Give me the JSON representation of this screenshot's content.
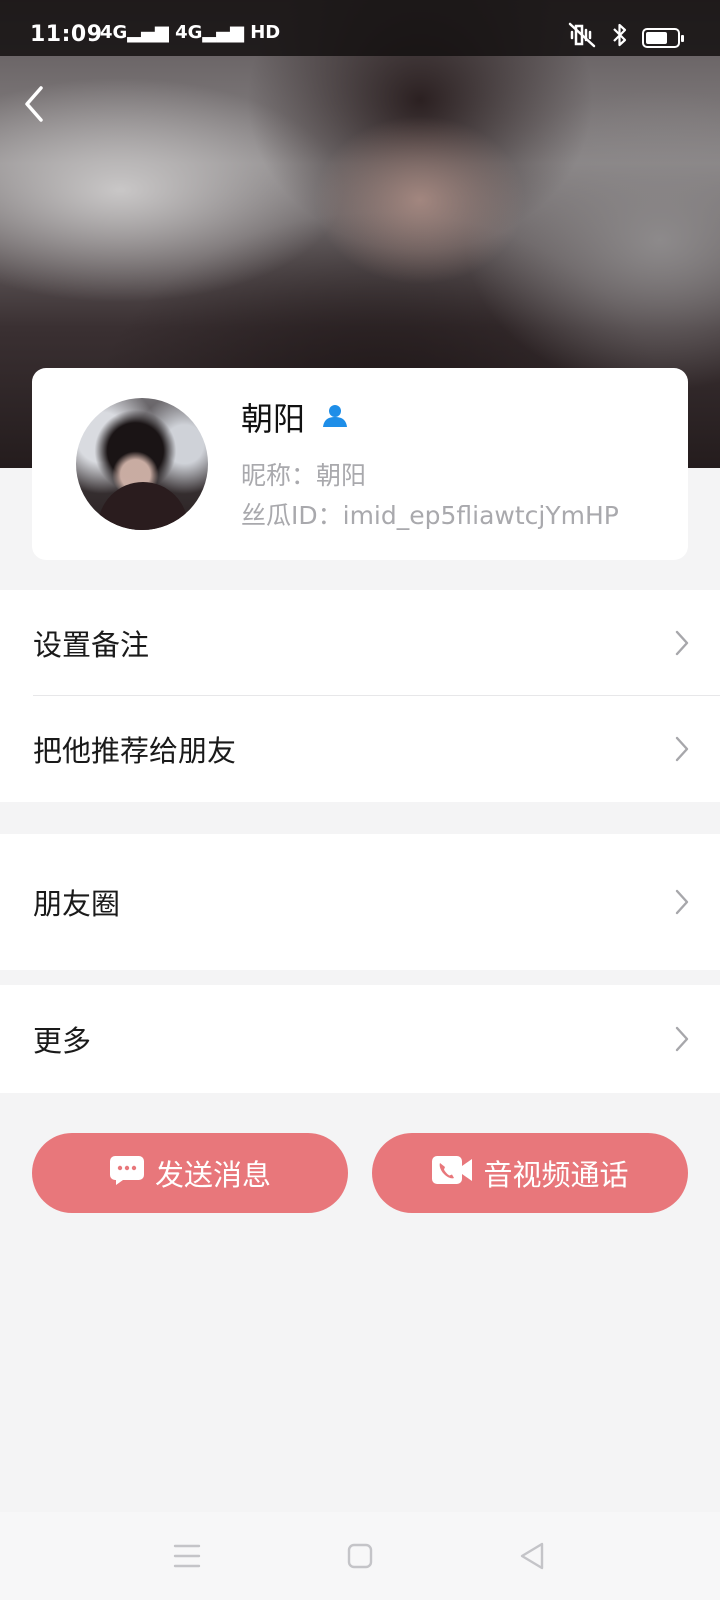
{
  "status_bar": {
    "time": "11:09",
    "signal": "4G▂▄▆ 4G▂▄▆ HD",
    "icons": [
      "mute-vibrate-icon",
      "bluetooth-icon",
      "battery-icon"
    ],
    "battery_level": 0.7
  },
  "header": {
    "back_icon": "chevron-left-icon"
  },
  "profile": {
    "name": "朝阳",
    "name_badge_icon": "person-icon",
    "nickname": "昵称：朝阳",
    "id": "丝瓜ID：imid_ep5fliawtcjYmHP"
  },
  "menu": {
    "group1": [
      {
        "label": "设置备注"
      },
      {
        "label": "把他推荐给朋友"
      }
    ],
    "group2": [
      {
        "label": "朋友圈"
      }
    ],
    "group3": [
      {
        "label": "更多"
      }
    ]
  },
  "actions": {
    "send_message": "发送消息",
    "av_call": "音视频通话"
  },
  "colors": {
    "accent": "#e8777b",
    "badge_blue": "#1e8ee8",
    "background": "#f4f4f5"
  },
  "navbar": {
    "icons": [
      "menu-lines-icon",
      "home-square-icon",
      "back-triangle-icon"
    ]
  }
}
